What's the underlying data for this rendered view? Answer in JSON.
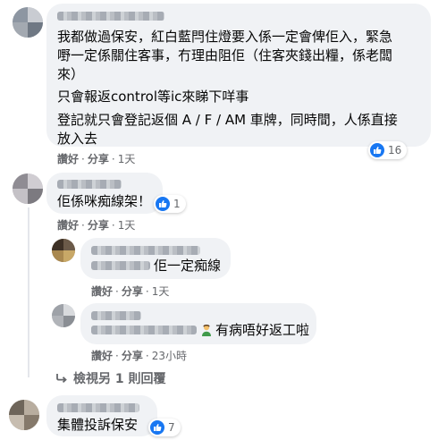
{
  "comments": [
    {
      "lines": [
        "我都做過保安，紅白藍閂住燈要入係一定會俾佢入，緊急",
        "嘢一定係關住客事，冇理由阻佢（住客夾錢出糧，係老闆",
        "來）",
        "只會報返control等ic來睇下咩事",
        "登記就只會登記返個 A / F / AM 車牌，同時間，人係直接",
        "放入去"
      ],
      "like_label": "讚好",
      "reply_label": "分享",
      "time": "1天",
      "reaction_count": "16"
    },
    {
      "text": "佢係咪痴線架！",
      "like_label": "讚好",
      "reply_label": "分享",
      "time": "1天",
      "reaction_count": "1"
    },
    {
      "text": "佢一定痴線",
      "like_label": "讚好",
      "reply_label": "分享",
      "time": "1天"
    },
    {
      "text": "有病唔好返工啦",
      "emoji": "person-emoji",
      "like_label": "讚好",
      "reply_label": "分享",
      "time": "23小時"
    },
    {
      "text": "集體投訴保安",
      "reaction_count": "7"
    }
  ],
  "view_more": "檢視另 1 則回覆",
  "icons": {
    "reaction": "like-icon",
    "reply_arrow": "reply-arrow-icon"
  },
  "colors": {
    "bubble": "#f0f2f5",
    "like_blue": "#1877f2",
    "meta_gray": "#65676b"
  }
}
